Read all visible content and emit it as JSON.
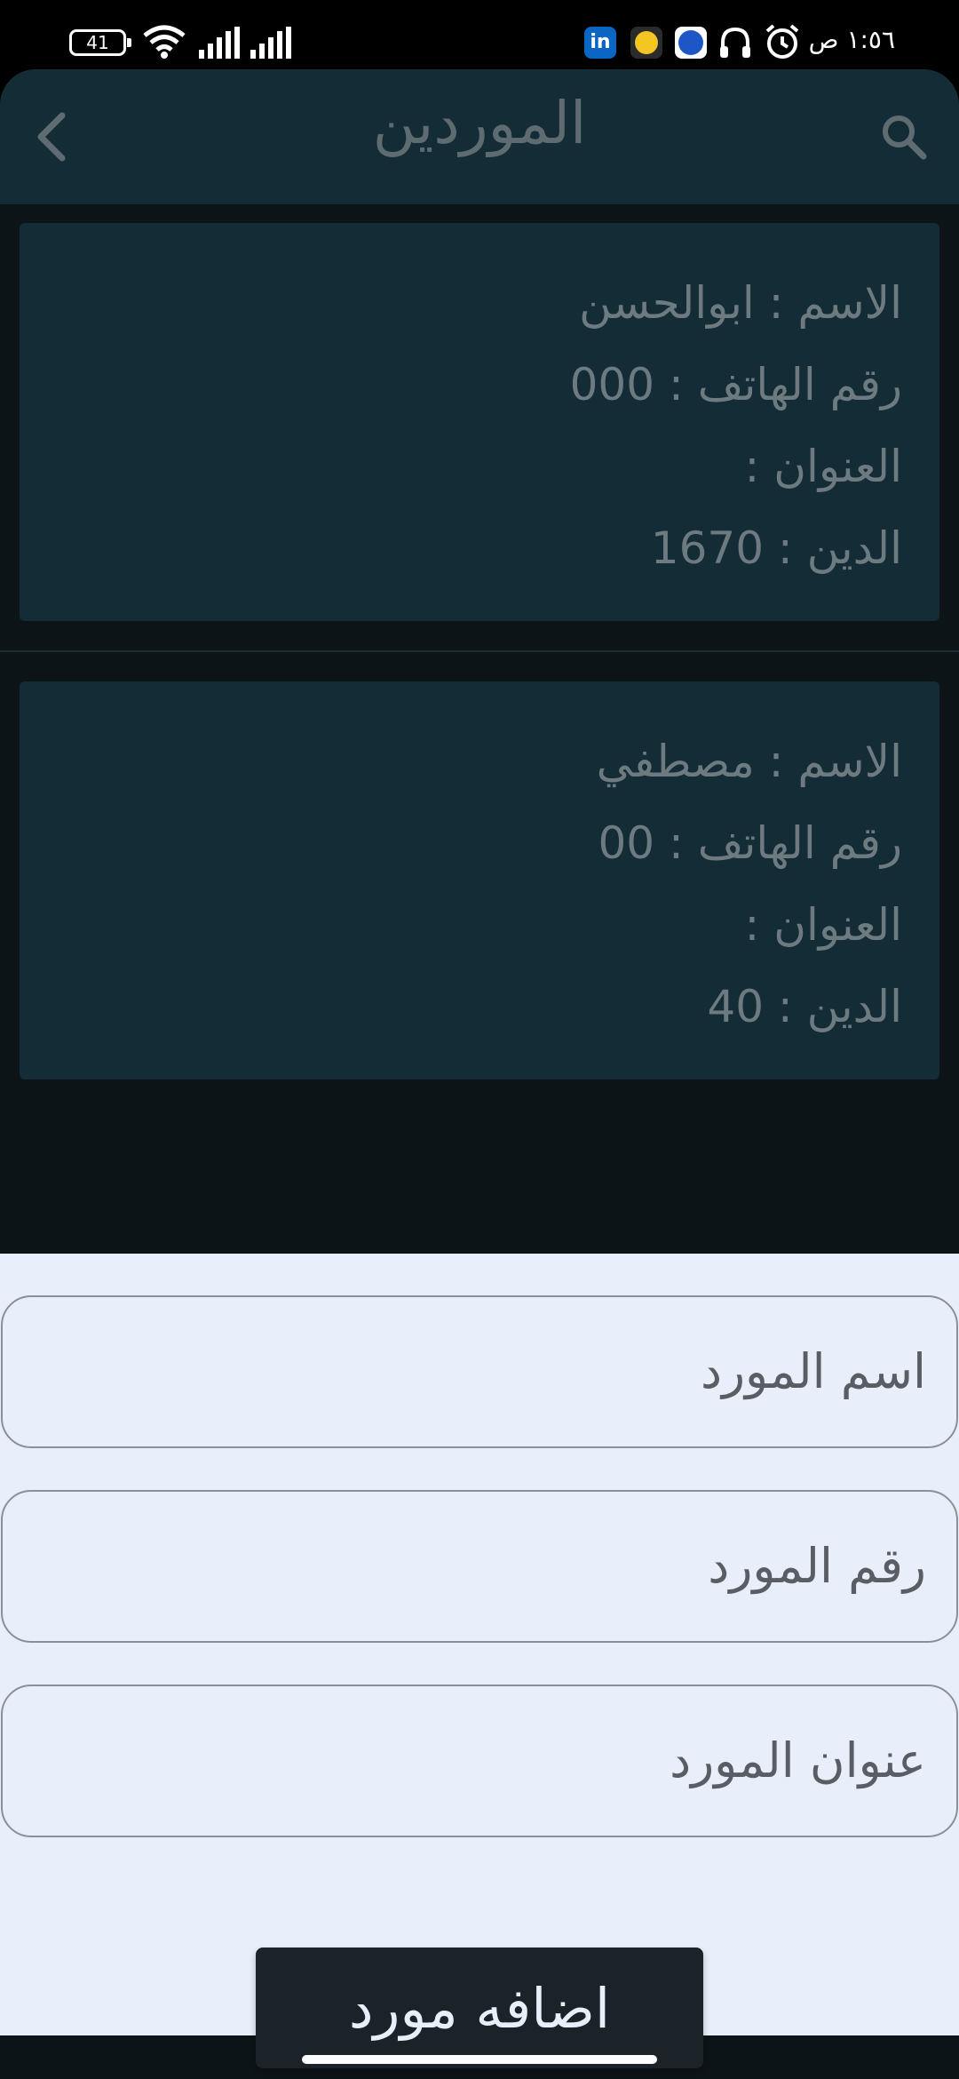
{
  "status_bar": {
    "battery": "41",
    "time": "١:٥٦ ص",
    "icons": [
      "battery-icon",
      "wifi-icon",
      "signal-icon",
      "signal-icon",
      "linkedin-icon",
      "coin-icon",
      "phone-app-icon",
      "headset-icon",
      "alarm-icon"
    ]
  },
  "app_bar": {
    "title": "الموردين",
    "back_icon": "chevron-left-icon",
    "search_icon": "search-icon"
  },
  "suppliers": [
    {
      "name_line": "الاسم : ابوالحسن",
      "phone_line": "رقم الهاتف : 000",
      "address_line": "العنوان :",
      "debt_line": "الدين : 1670"
    },
    {
      "name_line": "الاسم : مصطفي",
      "phone_line": "رقم الهاتف : 00",
      "address_line": "العنوان :",
      "debt_line": "الدين : 40"
    }
  ],
  "form": {
    "name_placeholder": "اسم المورد",
    "phone_placeholder": "رقم المورد",
    "address_placeholder": "عنوان المورد",
    "submit_label": "اضافه مورد"
  },
  "colors": {
    "app_bar": "#132c36",
    "background": "#0d1418",
    "sheet": "#e8effb",
    "button": "#1b2228"
  }
}
